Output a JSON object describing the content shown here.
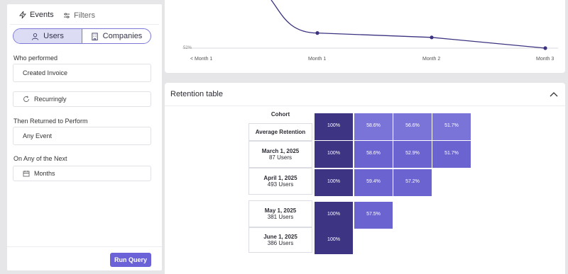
{
  "left_panel": {
    "tabs": [
      {
        "label": "Events",
        "icon": "bolt-icon",
        "active": true
      },
      {
        "label": "Filters",
        "icon": "sliders-icon",
        "active": false
      }
    ],
    "segment": [
      {
        "label": "Users",
        "icon": "user-icon",
        "active": true
      },
      {
        "label": "Companies",
        "icon": "building-icon",
        "active": false
      }
    ],
    "who_performed_label": "Who performed",
    "who_performed_value": "Created Invoice",
    "frequency_value": "Recurringly",
    "then_returned_label": "Then Returned to Perform",
    "then_returned_value": "Any Event",
    "next_label": "On Any of the Next",
    "next_value": "Months",
    "run_button": "Run Query"
  },
  "chart": {
    "y_tick_label": "52%",
    "x_labels": [
      "< Month 1",
      "Month 1",
      "Month 2",
      "Month 3"
    ],
    "colors": {
      "line": "#3b3380"
    }
  },
  "chart_data": {
    "type": "line",
    "categories": [
      "< Month 1",
      "Month 1",
      "Month 2",
      "Month 3"
    ],
    "series": [
      {
        "values": [
          100,
          58.6,
          56.6,
          51.7
        ]
      }
    ],
    "ylabel": "",
    "xlabel": "",
    "y_tick_visible": "52%"
  },
  "retention": {
    "title": "Retention table",
    "cohort_header": "Cohort",
    "rows": [
      {
        "label": "Average Retention",
        "users": "",
        "values": [
          "100%",
          "58.6%",
          "56.6%",
          "51.7%"
        ]
      },
      {
        "label": "March 1, 2025",
        "users": "87 Users",
        "values": [
          "100%",
          "58.6%",
          "52.9%",
          "51.7%"
        ]
      },
      {
        "label": "April 1, 2025",
        "users": "493 Users",
        "values": [
          "100%",
          "59.4%",
          "57.2%"
        ]
      },
      {
        "label": "May 1, 2025",
        "users": "381 Users",
        "values": [
          "100%",
          "57.5%"
        ]
      },
      {
        "label": "June 1, 2025",
        "users": "386 Users",
        "values": [
          "100%"
        ]
      }
    ],
    "colors": {
      "first_col": "#3d3583",
      "cell": "#6b63cf",
      "cell_light": "#7b74d8"
    }
  }
}
